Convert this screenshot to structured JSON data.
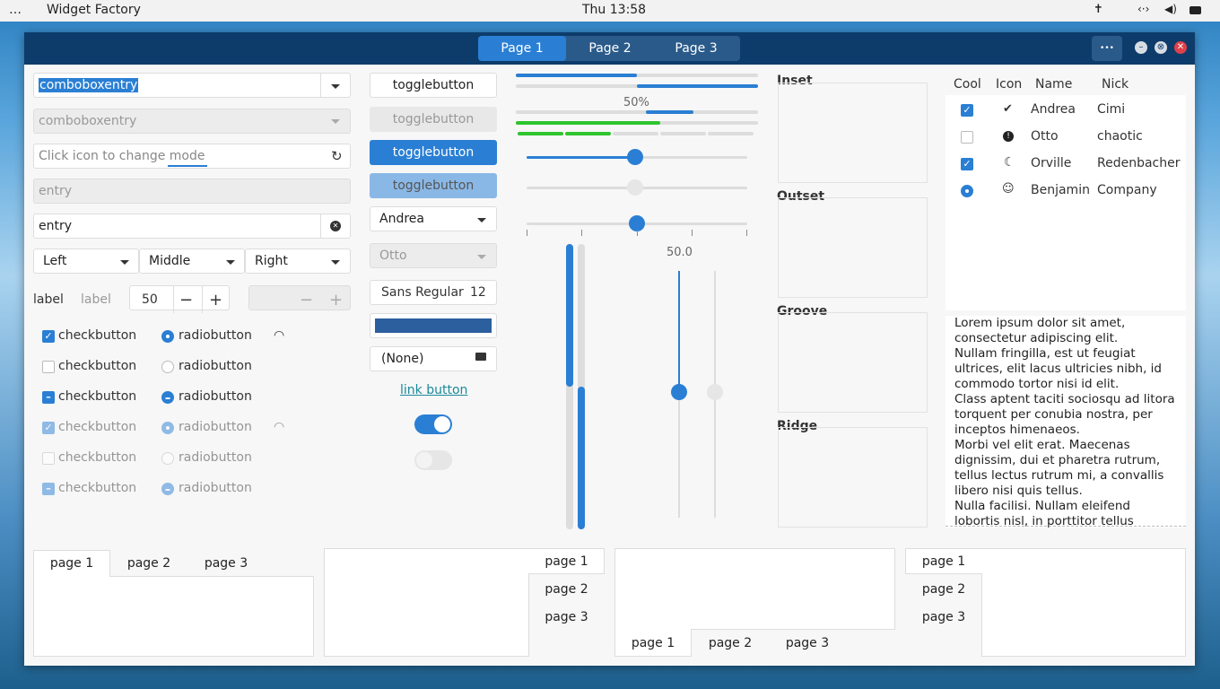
{
  "topbar": {
    "activities": "…",
    "app": "Widget Factory",
    "clock": "Thu 13:58"
  },
  "window": {
    "tabs": [
      "Page 1",
      "Page 2",
      "Page 3"
    ],
    "menu": "•••"
  },
  "col1": {
    "combo1": "comboboxentry",
    "combo2": "comboboxentry",
    "mode_placeholder": "Click icon to change mode",
    "entry_disabled": "entry",
    "entry": "entry",
    "seg": [
      "Left",
      "Middle",
      "Right"
    ],
    "label1": "label",
    "label2": "label",
    "spin": "50",
    "checks": [
      "checkbutton",
      "checkbutton",
      "checkbutton",
      "checkbutton",
      "checkbutton",
      "checkbutton"
    ],
    "radios": [
      "radiobutton",
      "radiobutton",
      "radiobutton",
      "radiobutton",
      "radiobutton",
      "radiobutton"
    ]
  },
  "col2": {
    "toggles": [
      "togglebutton",
      "togglebutton",
      "togglebutton",
      "togglebutton"
    ],
    "combo_andrea": "Andrea",
    "combo_otto": "Otto",
    "font": "Sans Regular",
    "font_size": "12",
    "file": "(None)",
    "link": "link button"
  },
  "col3": {
    "progress_label": "50%",
    "scale_value": "50.0",
    "progress": 0.5
  },
  "frames": [
    "Inset",
    "Outset",
    "Groove",
    "Ridge"
  ],
  "tree": {
    "headers": [
      "Cool",
      "Icon",
      "Name",
      "Nick"
    ],
    "rows": [
      {
        "name": "Andrea",
        "nick": "Cimi",
        "icon": "check-circle-icon"
      },
      {
        "name": "Otto",
        "nick": "chaotic",
        "icon": "warning-icon"
      },
      {
        "name": "Orville",
        "nick": "Redenbacher",
        "icon": "moon-icon"
      },
      {
        "name": "Benjamin",
        "nick": "Company",
        "icon": "face-icon"
      }
    ]
  },
  "text": "Lorem ipsum dolor sit amet, consectetur adipiscing elit.\nNullam fringilla, est ut feugiat ultrices, elit lacus ultricies nibh, id commodo tortor nisi id elit.\nClass aptent taciti sociosqu ad litora torquent per conubia nostra, per inceptos himenaeos.\nMorbi vel elit erat. Maecenas dignissim, dui et pharetra rutrum, tellus lectus rutrum mi, a convallis libero nisi quis tellus.\nNulla facilisi. Nullam eleifend lobortis nisl, in porttitor tellus",
  "notebooks": [
    [
      "page 1",
      "page 2",
      "page 3"
    ],
    [
      "page 1",
      "page 2",
      "page 3"
    ],
    [
      "page 1",
      "page 2",
      "page 3"
    ],
    [
      "page 1",
      "page 2",
      "page 3"
    ]
  ],
  "colors": {
    "accent": "#2a7fd4",
    "header": "#0d3c6b",
    "green": "#2ec52e",
    "colorbutton": "#2b5f9e"
  }
}
